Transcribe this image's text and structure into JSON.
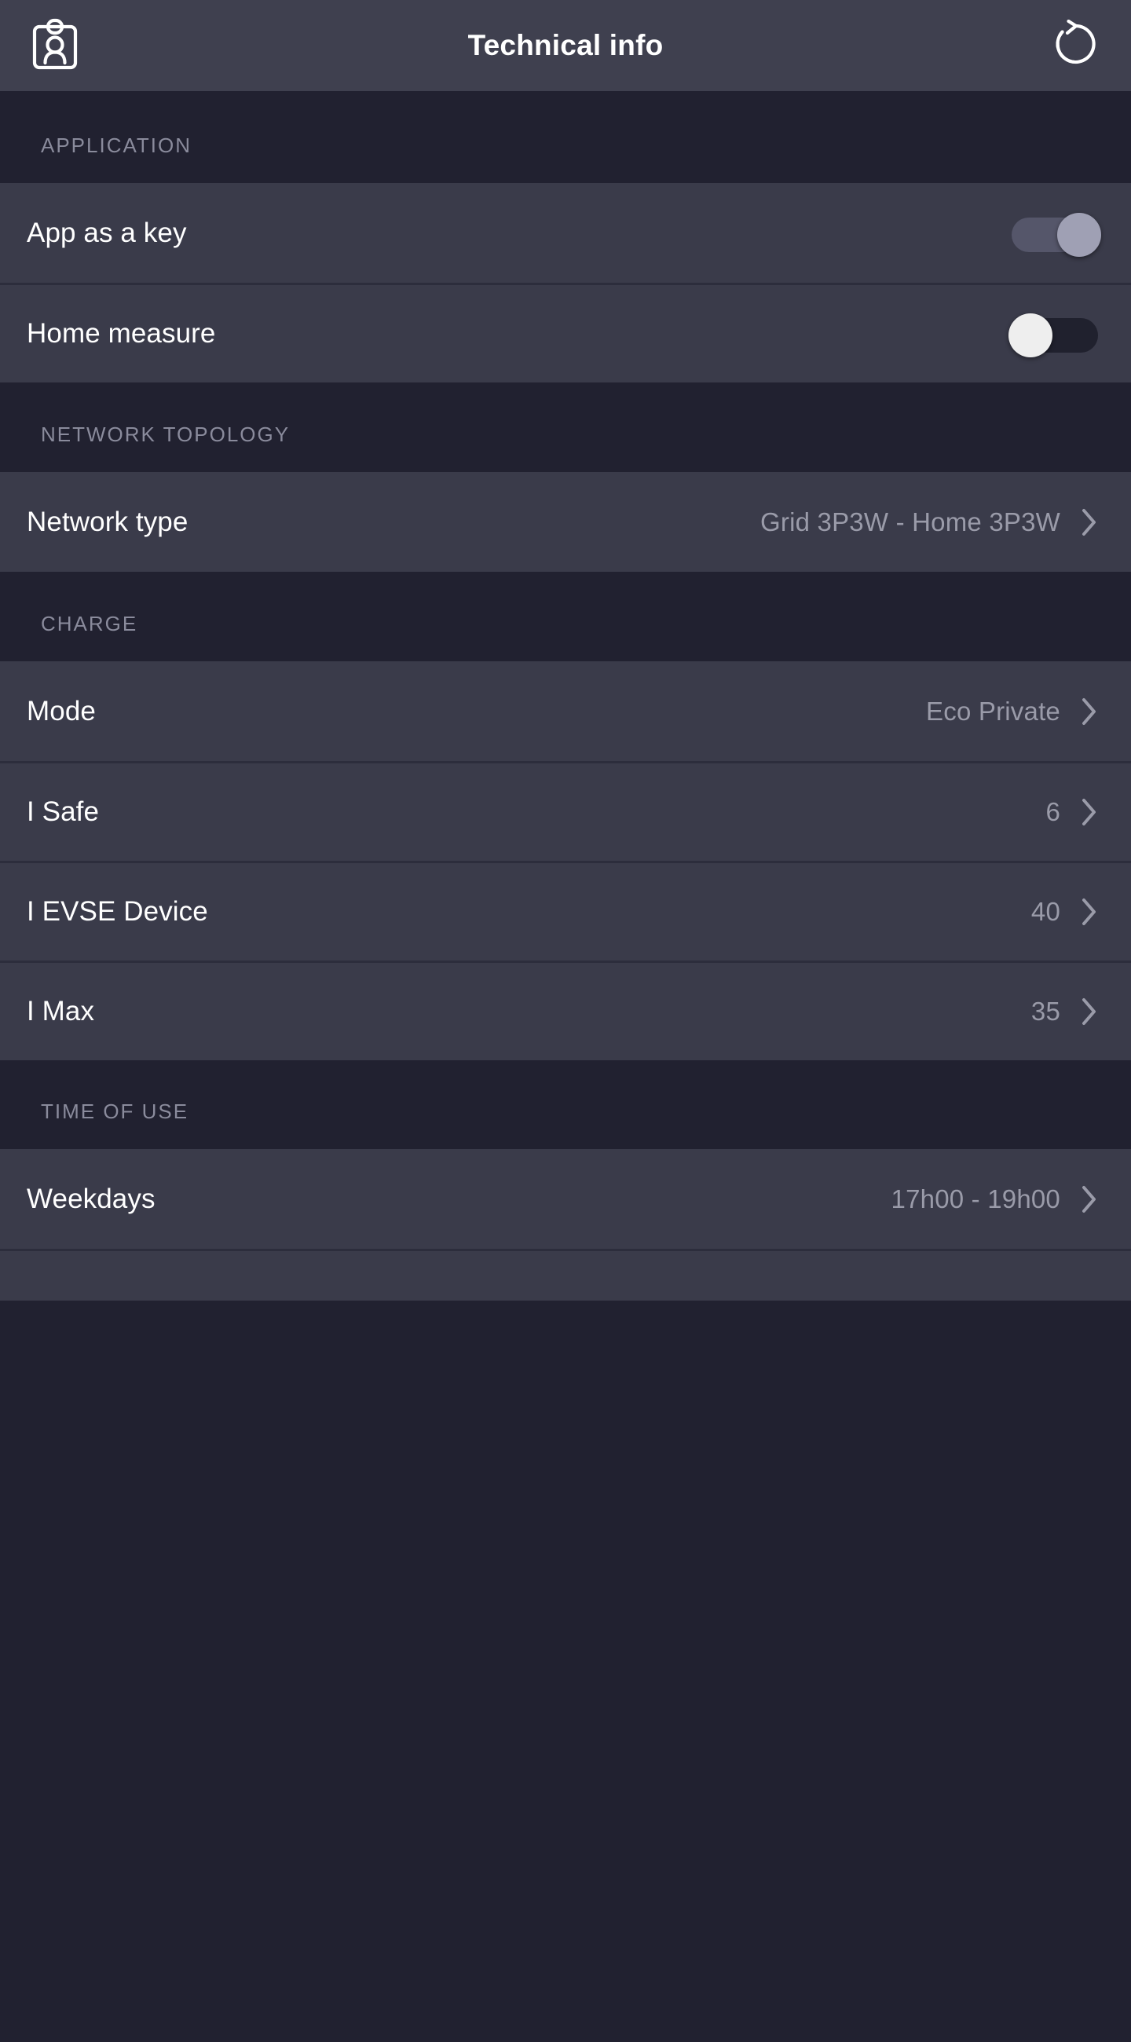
{
  "header": {
    "title": "Technical info",
    "left_icon": "id-badge-icon",
    "right_icon": "reset-refresh-icon"
  },
  "sections": [
    {
      "title": "APPLICATION",
      "rows": [
        {
          "label": "App as a key",
          "control": "toggle",
          "value": "on",
          "icon": ""
        },
        {
          "label": "Home measure",
          "control": "toggle",
          "value": "off",
          "icon": ""
        }
      ]
    },
    {
      "title": "NETWORK TOPOLOGY",
      "rows": [
        {
          "label": "Network type",
          "control": "chevron",
          "value": "Grid 3P3W - Home 3P3W",
          "icon": "chevron-right-icon"
        }
      ]
    },
    {
      "title": "CHARGE",
      "rows": [
        {
          "label": "Mode",
          "control": "chevron",
          "value": "Eco Private",
          "icon": "chevron-right-icon"
        },
        {
          "label": "I Safe",
          "control": "chevron",
          "value": "6",
          "icon": "chevron-right-icon"
        },
        {
          "label": "I EVSE Device",
          "control": "chevron",
          "value": "40",
          "icon": "chevron-right-icon"
        },
        {
          "label": "I Max",
          "control": "chevron",
          "value": "35",
          "icon": "chevron-right-icon"
        }
      ]
    },
    {
      "title": "TIME OF USE",
      "rows": [
        {
          "label": "Weekdays",
          "control": "chevron",
          "value": "17h00 - 19h00",
          "icon": "chevron-right-icon"
        }
      ]
    }
  ],
  "colors": {
    "appbar_bg": "#3f404f",
    "section_bg": "#212130",
    "row_bg": "#3a3b4a",
    "divider": "#2c2d3c",
    "label_text": "#ffffff",
    "value_text": "#9a9ba9",
    "section_text": "#8a8b9c",
    "toggle_on_thumb": "#9fa0b4",
    "toggle_on_track": "#55566a",
    "toggle_off_thumb": "#eeeeee",
    "toggle_off_track": "#20212e"
  }
}
